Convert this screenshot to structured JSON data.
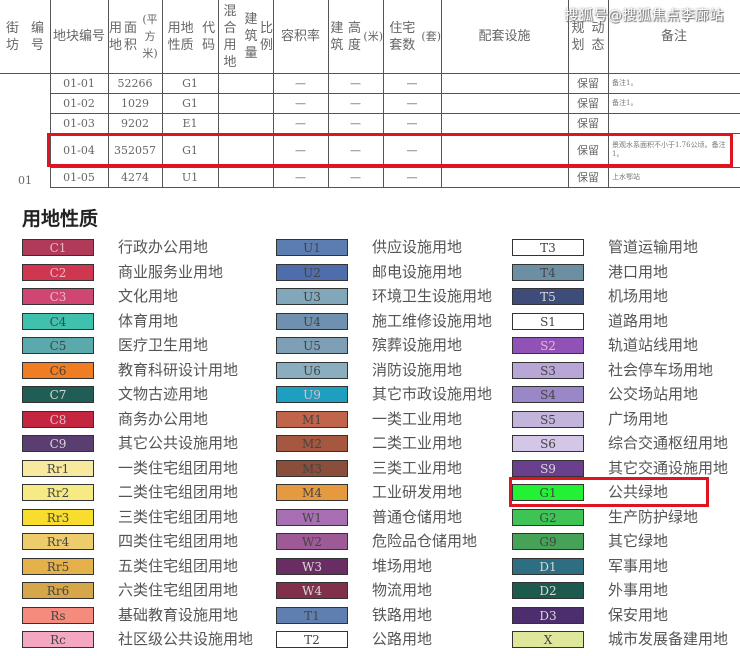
{
  "table": {
    "headers": [
      {
        "key": "jiefang",
        "label": "街坊编号"
      },
      {
        "key": "plot",
        "label": "地块编号"
      },
      {
        "key": "area",
        "label": "用地面积(平方米)"
      },
      {
        "key": "code",
        "label": "用地性质代码"
      },
      {
        "key": "mixed",
        "label": "混合用地建筑量比例"
      },
      {
        "key": "far",
        "label": "容积率"
      },
      {
        "key": "height",
        "label": "建筑高度(米)"
      },
      {
        "key": "units",
        "label": "住宅套数(套)"
      },
      {
        "key": "facilities",
        "label": "配套设施"
      },
      {
        "key": "plan",
        "label": "规划动态"
      },
      {
        "key": "note",
        "label": "备注"
      }
    ],
    "header_lines": {
      "jiefang": [
        "街坊",
        "编号"
      ],
      "plot": [
        "地块",
        "编号"
      ],
      "area": [
        "用地",
        "面积",
        "(平方米)"
      ],
      "code": [
        "用地性质",
        "代码"
      ],
      "mixed": [
        "混合用地",
        "建筑量",
        "比例"
      ],
      "far": [
        "容积率"
      ],
      "height": [
        "建筑",
        "高度",
        "(米)"
      ],
      "units": [
        "住宅套数",
        "(套)"
      ],
      "facilities": [
        "配套设施"
      ],
      "plan": [
        "规划",
        "动态"
      ],
      "note": [
        "备注"
      ]
    },
    "jiefang_value": "01",
    "rows": [
      {
        "plot": "01-01",
        "area": "52266",
        "code": "G1",
        "mixed": "",
        "far": "—",
        "height": "—",
        "units": "—",
        "facilities": "",
        "plan": "保留",
        "note": "备注1。"
      },
      {
        "plot": "01-02",
        "area": "1029",
        "code": "G1",
        "mixed": "",
        "far": "—",
        "height": "—",
        "units": "—",
        "facilities": "",
        "plan": "保留",
        "note": "备注1。"
      },
      {
        "plot": "01-03",
        "area": "9202",
        "code": "E1",
        "mixed": "",
        "far": "—",
        "height": "—",
        "units": "—",
        "facilities": "",
        "plan": "保留",
        "note": ""
      },
      {
        "plot": "01-04",
        "area": "352057",
        "code": "G1",
        "mixed": "",
        "far": "—",
        "height": "—",
        "units": "—",
        "facilities": "",
        "plan": "保留",
        "note": "景观水系面积不小于1.76公顷。备注1。"
      },
      {
        "plot": "01-05",
        "area": "4274",
        "code": "U1",
        "mixed": "",
        "far": "—",
        "height": "—",
        "units": "—",
        "facilities": "",
        "plan": "保留",
        "note": "上水鄂站"
      }
    ],
    "highlighted_row": "01-04"
  },
  "watermark": "搜狐号@搜狐焦点李廊站",
  "legend": {
    "title": "用地性质",
    "selected_code": "G1",
    "columns": [
      [
        {
          "code": "C1",
          "label": "行政办公用地",
          "color": "#b03a57"
        },
        {
          "code": "C2",
          "label": "商业服务业用地",
          "color": "#d0364f"
        },
        {
          "code": "C3",
          "label": "文化用地",
          "color": "#d04673"
        },
        {
          "code": "C4",
          "label": "体育用地",
          "color": "#3fc1ad"
        },
        {
          "code": "C5",
          "label": "医疗卫生用地",
          "color": "#5aa9ad"
        },
        {
          "code": "C6",
          "label": "教育科研设计用地",
          "color": "#f07d22"
        },
        {
          "code": "C7",
          "label": "文物古迹用地",
          "color": "#1f5d55"
        },
        {
          "code": "C8",
          "label": "商务办公用地",
          "color": "#c4263f"
        },
        {
          "code": "C9",
          "label": "其它公共设施用地",
          "color": "#5a3e72"
        },
        {
          "code": "Rr1",
          "label": "一类住宅组团用地",
          "color": "#f7eaa0"
        },
        {
          "code": "Rr2",
          "label": "二类住宅组团用地",
          "color": "#f5ea84"
        },
        {
          "code": "Rr3",
          "label": "三类住宅组团用地",
          "color": "#f8dd2e"
        },
        {
          "code": "Rr4",
          "label": "四类住宅组团用地",
          "color": "#eecb6b"
        },
        {
          "code": "Rr5",
          "label": "五类住宅组团用地",
          "color": "#e4b14b"
        },
        {
          "code": "Rr6",
          "label": "六类住宅组团用地",
          "color": "#d6a64a"
        },
        {
          "code": "Rs",
          "label": "基础教育设施用地",
          "color": "#f58b7c"
        },
        {
          "code": "Rc",
          "label": "社区级公共设施用地",
          "color": "#f3a8bf"
        }
      ],
      [
        {
          "code": "U1",
          "label": "供应设施用地",
          "color": "#5b7db0"
        },
        {
          "code": "U2",
          "label": "邮电设施用地",
          "color": "#4f6cab"
        },
        {
          "code": "U3",
          "label": "环境卫生设施用地",
          "color": "#80a7ba"
        },
        {
          "code": "U4",
          "label": "施工维修设施用地",
          "color": "#6f90ae"
        },
        {
          "code": "U5",
          "label": "殡葬设施用地",
          "color": "#7e9fb5"
        },
        {
          "code": "U6",
          "label": "消防设施用地",
          "color": "#8aaec0"
        },
        {
          "code": "U9",
          "label": "其它市政设施用地",
          "color": "#1e9fbf"
        },
        {
          "code": "M1",
          "label": "一类工业用地",
          "color": "#c0654c"
        },
        {
          "code": "M2",
          "label": "二类工业用地",
          "color": "#a6573f"
        },
        {
          "code": "M3",
          "label": "三类工业用地",
          "color": "#8a4e3a"
        },
        {
          "code": "M4",
          "label": "工业研发用地",
          "color": "#e69a40"
        },
        {
          "code": "W1",
          "label": "普通仓储用地",
          "color": "#a86fb2"
        },
        {
          "code": "W2",
          "label": "危险品仓储用地",
          "color": "#9e5a96"
        },
        {
          "code": "W3",
          "label": "堆场用地",
          "color": "#6a2d63"
        },
        {
          "code": "W4",
          "label": "物流用地",
          "color": "#80304c"
        },
        {
          "code": "T1",
          "label": "铁路用地",
          "color": "#5f7fb0"
        },
        {
          "code": "T2",
          "label": "公路用地",
          "color": "#ffffff"
        }
      ],
      [
        {
          "code": "T3",
          "label": "管道运输用地",
          "color": "#ffffff"
        },
        {
          "code": "T4",
          "label": "港口用地",
          "color": "#6c8fa3"
        },
        {
          "code": "T5",
          "label": "机场用地",
          "color": "#3d4c78"
        },
        {
          "code": "S1",
          "label": "道路用地",
          "color": "#ffffff"
        },
        {
          "code": "S2",
          "label": "轨道站线用地",
          "color": "#9152b8"
        },
        {
          "code": "S3",
          "label": "社会停车场用地",
          "color": "#b8a6d6"
        },
        {
          "code": "S4",
          "label": "公交场站用地",
          "color": "#9987c7"
        },
        {
          "code": "S5",
          "label": "广场用地",
          "color": "#c3b4dc"
        },
        {
          "code": "S6",
          "label": "综合交通枢纽用地",
          "color": "#d3c6e6"
        },
        {
          "code": "S9",
          "label": "其它交通设施用地",
          "color": "#6a3f8e"
        },
        {
          "code": "G1",
          "label": "公共绿地",
          "color": "#22f233"
        },
        {
          "code": "G2",
          "label": "生产防护绿地",
          "color": "#3ec454"
        },
        {
          "code": "G9",
          "label": "其它绿地",
          "color": "#46a256"
        },
        {
          "code": "D1",
          "label": "军事用地",
          "color": "#2e6e82"
        },
        {
          "code": "D2",
          "label": "外事用地",
          "color": "#1d5a4e"
        },
        {
          "code": "D3",
          "label": "保安用地",
          "color": "#4c2e6e"
        },
        {
          "code": "X",
          "label": "城市发展备建用地",
          "color": "#dfe79a"
        }
      ]
    ]
  }
}
